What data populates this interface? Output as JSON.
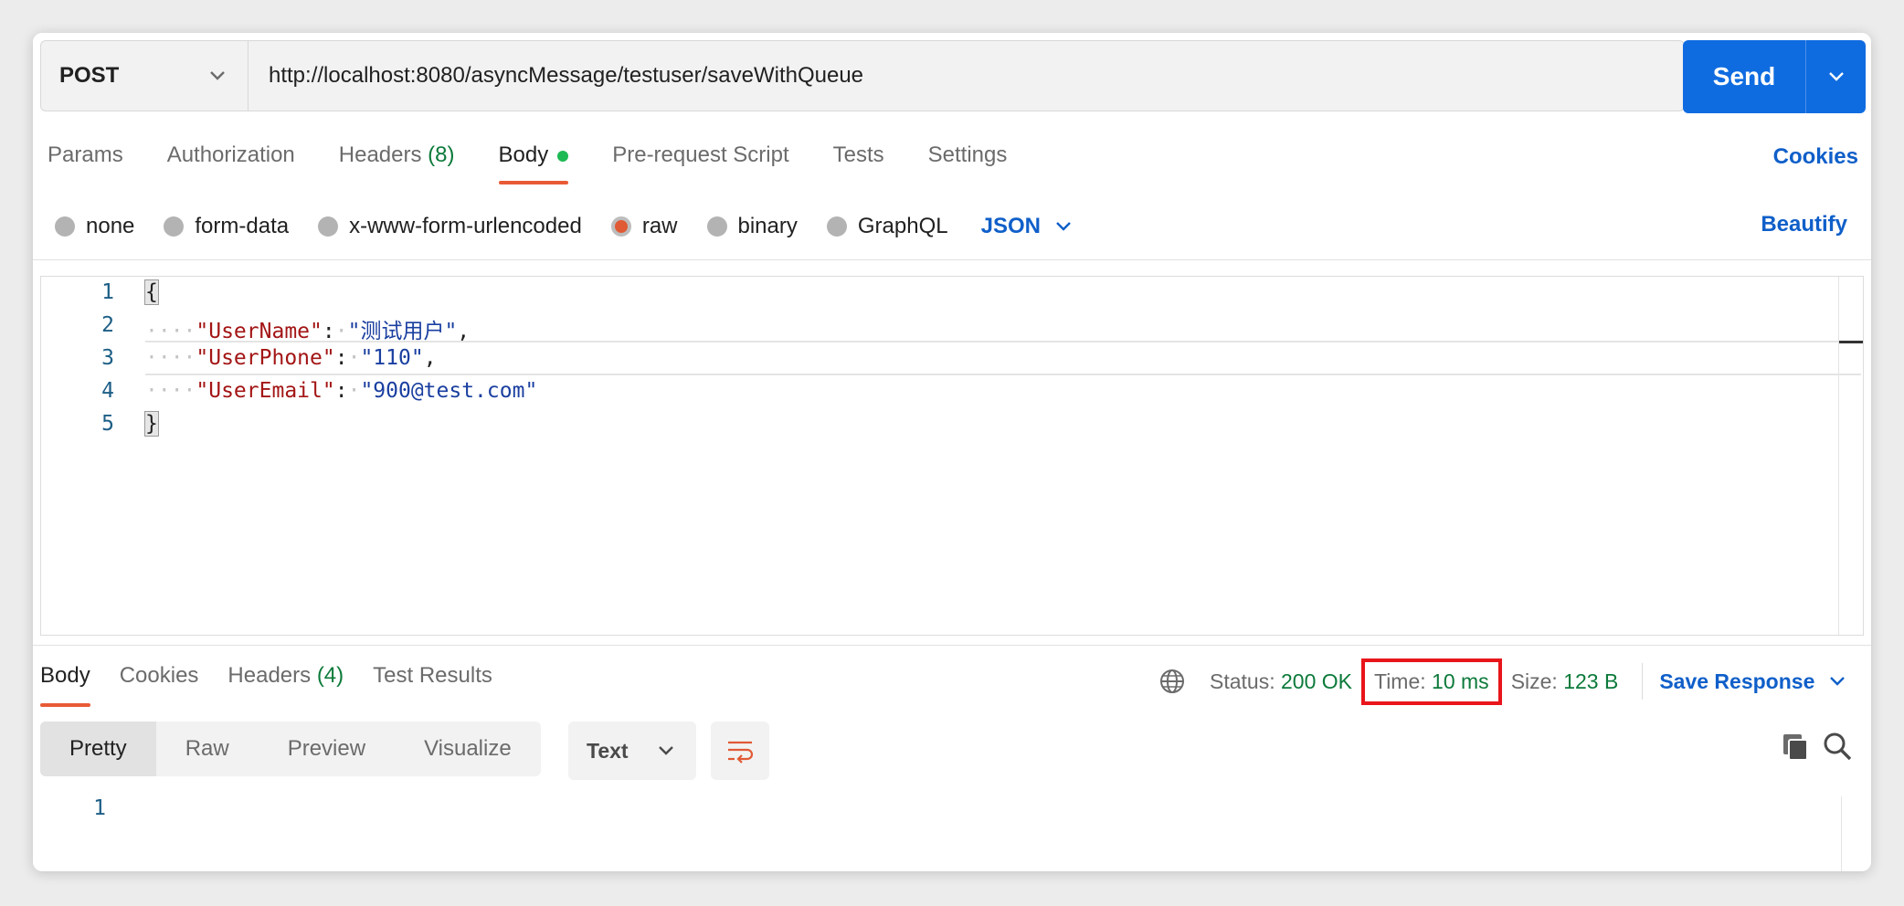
{
  "request": {
    "method": "POST",
    "url": "http://localhost:8080/asyncMessage/testuser/saveWithQueue",
    "send_label": "Send"
  },
  "request_tabs": [
    {
      "label": "Params"
    },
    {
      "label": "Authorization"
    },
    {
      "label": "Headers",
      "count": "(8)"
    },
    {
      "label": "Body"
    },
    {
      "label": "Pre-request Script"
    },
    {
      "label": "Tests"
    },
    {
      "label": "Settings"
    }
  ],
  "cookies_label": "Cookies",
  "body_types": [
    "none",
    "form-data",
    "x-www-form-urlencoded",
    "raw",
    "binary",
    "GraphQL"
  ],
  "selected_body_type": "raw",
  "body_format": "JSON",
  "beautify_label": "Beautify",
  "editor": {
    "line_numbers": [
      "1",
      "2",
      "3",
      "4",
      "5"
    ],
    "open_brace": "{",
    "close_brace": "}",
    "fields": [
      {
        "key": "\"UserName\"",
        "value": "\"测试用户\"",
        "comma": ","
      },
      {
        "key": "\"UserPhone\"",
        "value": "\"110\"",
        "comma": ","
      },
      {
        "key": "\"UserEmail\"",
        "value": "\"900@test.com\"",
        "comma": ""
      }
    ]
  },
  "response_tabs": [
    {
      "label": "Body"
    },
    {
      "label": "Cookies"
    },
    {
      "label": "Headers",
      "count": "(4)"
    },
    {
      "label": "Test Results"
    }
  ],
  "response_status": {
    "status_label": "Status:",
    "status_value": "200 OK",
    "time_label": "Time:",
    "time_value": "10 ms",
    "size_label": "Size:",
    "size_value": "123 B",
    "save_label": "Save Response"
  },
  "view_modes": [
    "Pretty",
    "Raw",
    "Preview",
    "Visualize"
  ],
  "response_format": "Text",
  "response_line_numbers": [
    "1"
  ],
  "colors": {
    "accent": "#0f6ce0",
    "tab_indicator": "#e85a36",
    "highlight_box": "#e8151b",
    "success": "#0c7a3a"
  },
  "icons": [
    "chevron-down-icon",
    "globe-icon",
    "wrap-lines-icon",
    "copy-icon",
    "search-icon"
  ]
}
